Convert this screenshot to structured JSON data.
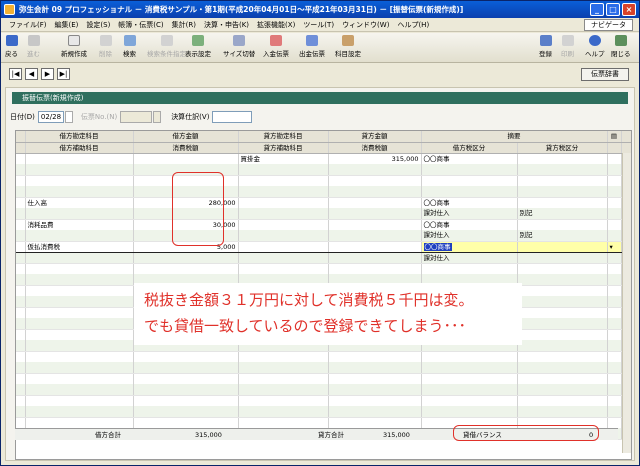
{
  "window": {
    "title": "弥生会計 09 プロフェッショナル － 消費税サンプル・第1期(平成20年04月01日～平成21年03月31日) － [振替伝票(新規作成)]"
  },
  "menu": [
    "ファイル(F)",
    "編集(E)",
    "設定(S)",
    "帳簿・伝票(C)",
    "集計(R)",
    "決算・申告(K)",
    "拡張機能(X)",
    "ツール(T)",
    "ウィンドウ(W)",
    "ヘルプ(H)"
  ],
  "navi": "ナビゲータ",
  "toolbar": {
    "back": "戻る",
    "forward": "進む",
    "new": "新規作成",
    "delete": "削除",
    "search": "検索",
    "search_cond": "検索条件指定",
    "display_settings": "表示設定",
    "size_toggle": "サイズ切替",
    "receipt_slip": "入金伝票",
    "payment_slip": "出金伝票",
    "account_settings": "科目設定",
    "register": "登録",
    "print": "印刷",
    "help": "ヘルプ",
    "close": "閉じる"
  },
  "nav": {
    "first": "|◀",
    "prev": "◀",
    "next": "▶",
    "last": "▶|",
    "dictionary_button": "伝票辞書"
  },
  "panel": {
    "title": "振替伝票(新規作成)",
    "date_label": "日付(D)",
    "date_value": "02/28",
    "slip_no_label": "伝票No.(N)",
    "settlement_label": "決算仕訳(V)"
  },
  "grid": {
    "header1": [
      "借方勘定科目",
      "借方金額",
      "貸方勘定科目",
      "貸方金額",
      "摘要"
    ],
    "header2": [
      "借方補助科目",
      "消費税額",
      "貸方補助科目",
      "消費税額",
      "借方税区分",
      "貸方税区分"
    ],
    "rows": [
      {
        "dr_account": "",
        "dr_amount": "",
        "cr_account": "買掛金",
        "cr_amount": "315,000",
        "memo": "〇〇商事",
        "dr_tax_class": "",
        "cr_tax_class": ""
      },
      {
        "dr_account": "仕入高",
        "dr_amount": "280,000",
        "cr_account": "",
        "cr_amount": "",
        "memo": "〇〇商事",
        "dr_tax_class": "課対仕入",
        "cr_tax_class": "別記"
      },
      {
        "dr_account": "消耗品費",
        "dr_amount": "30,000",
        "cr_account": "",
        "cr_amount": "",
        "memo": "〇〇商事",
        "dr_tax_class": "課対仕入",
        "cr_tax_class": "別記"
      },
      {
        "dr_account": "仮払消費税",
        "dr_amount": "5,000",
        "cr_account": "",
        "cr_amount": "",
        "memo": "〇〇商事",
        "dr_tax_class": "課対仕入",
        "cr_tax_class": ""
      }
    ],
    "footer": {
      "dr_total_label": "借方合計",
      "dr_total": "315,000",
      "cr_total_label": "貸方合計",
      "cr_total": "315,000",
      "balance_label": "貸借バランス",
      "balance": "0"
    }
  },
  "annotation": {
    "line1": "税抜き金額３１万円に対して消費税５千円は変。",
    "line2": "でも貸借一致しているので登録できてしまう･･･"
  }
}
